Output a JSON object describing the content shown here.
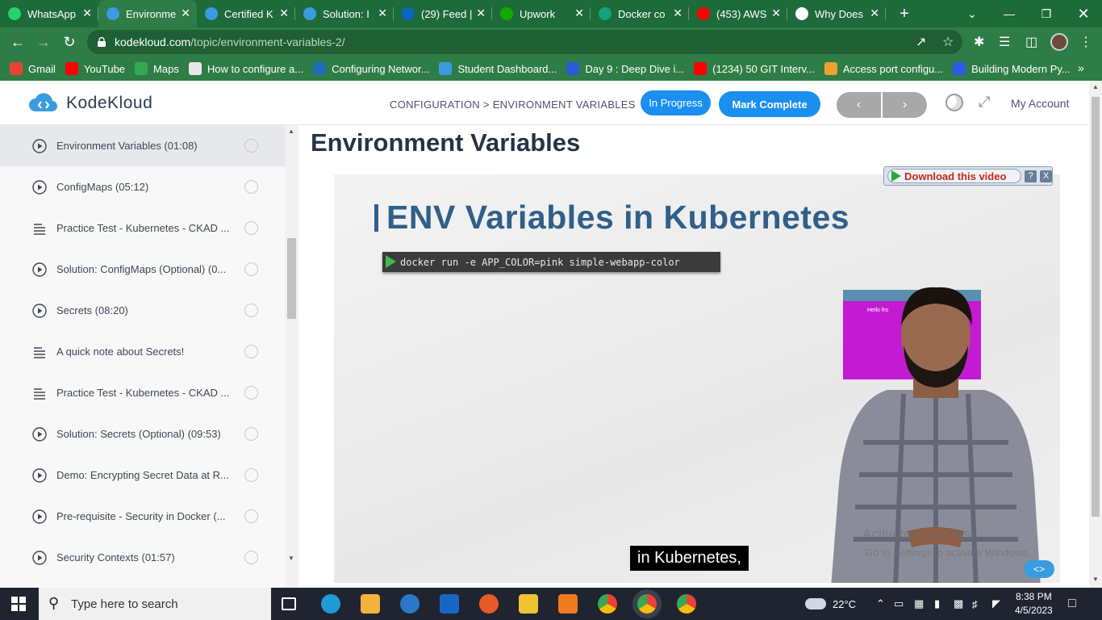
{
  "browser": {
    "tabs": [
      {
        "label": "WhatsApp",
        "icon": "whatsapp-icon",
        "color": "#25d366",
        "active": false
      },
      {
        "label": "Environme",
        "icon": "kodekloud-icon",
        "color": "#3b9be0",
        "active": true
      },
      {
        "label": "Certified K",
        "icon": "kodekloud-icon",
        "color": "#3b9be0",
        "active": false
      },
      {
        "label": "Solution: I",
        "icon": "kodekloud-icon",
        "color": "#3b9be0",
        "active": false
      },
      {
        "label": "(29) Feed |",
        "icon": "linkedin-icon",
        "color": "#0a66c2",
        "active": false
      },
      {
        "label": "Upwork",
        "icon": "upwork-icon",
        "color": "#14a800",
        "active": false
      },
      {
        "label": "Docker co",
        "icon": "openai-icon",
        "color": "#10a37f",
        "active": false
      },
      {
        "label": "(453) AWS",
        "icon": "youtube-icon",
        "color": "#ff0000",
        "active": false
      },
      {
        "label": "Why Does",
        "icon": "location-pin-icon",
        "color": "#ffffff",
        "active": false
      }
    ],
    "url_host": "kodekloud.com",
    "url_path": "/topic/environment-variables-2/",
    "bookmarks": [
      {
        "label": "Gmail",
        "icon": "gmail-icon",
        "color": "#ea4335"
      },
      {
        "label": "YouTube",
        "icon": "youtube-icon",
        "color": "#ff0000"
      },
      {
        "label": "Maps",
        "icon": "maps-icon",
        "color": "#34a853"
      },
      {
        "label": "How to configure a...",
        "icon": "page-icon",
        "color": "#e8e8e8"
      },
      {
        "label": "Configuring Networ...",
        "icon": "vmware-icon",
        "color": "#1d6fb8"
      },
      {
        "label": "Student Dashboard...",
        "icon": "kodekloud-icon",
        "color": "#3b9be0"
      },
      {
        "label": "Day 9 : Deep Dive i...",
        "icon": "diamond-icon",
        "color": "#2a5bd7"
      },
      {
        "label": "(1234) 50 GIT Interv...",
        "icon": "youtube-icon",
        "color": "#ff0000"
      },
      {
        "label": "Access port configu...",
        "icon": "blog-icon",
        "color": "#f0a030"
      },
      {
        "label": "Building Modern Py...",
        "icon": "c-icon",
        "color": "#2d5be3"
      }
    ]
  },
  "site": {
    "logo_text": "KodeKloud",
    "breadcrumb": "CONFIGURATION > ENVIRONMENT VARIABLES",
    "status_label": "In Progress",
    "mark_complete_label": "Mark Complete",
    "account_label": "My Account",
    "page_title": "Environment Variables"
  },
  "lessons": [
    {
      "label": "Environment Variables (01:08)",
      "type": "video",
      "active": true
    },
    {
      "label": "ConfigMaps (05:12)",
      "type": "video",
      "active": false
    },
    {
      "label": "Practice Test - Kubernetes - CKAD ...",
      "type": "text",
      "active": false
    },
    {
      "label": "Solution: ConfigMaps (Optional) (0...",
      "type": "video",
      "active": false
    },
    {
      "label": "Secrets (08:20)",
      "type": "video",
      "active": false
    },
    {
      "label": "A quick note about Secrets!",
      "type": "text",
      "active": false
    },
    {
      "label": "Practice Test - Kubernetes - CKAD ...",
      "type": "text",
      "active": false
    },
    {
      "label": "Solution: Secrets (Optional) (09:53)",
      "type": "video",
      "active": false
    },
    {
      "label": "Demo: Encrypting Secret Data at R...",
      "type": "video",
      "active": false
    },
    {
      "label": "Pre-requisite - Security in Docker (...",
      "type": "video",
      "active": false
    },
    {
      "label": "Security Contexts (01:57)",
      "type": "video",
      "active": false
    }
  ],
  "video": {
    "slide_title": "ENV Variables in Kubernetes",
    "command": "docker run  -e APP_COLOR=pink simple-webapp-color",
    "mini_text": "Hello fro",
    "caption": "in Kubernetes,",
    "watermark_line1": "Activate Windows",
    "watermark_line2": "Go to Settings to activate Windows.",
    "download_label": "Download this video",
    "help_label": "?",
    "close_label": "X"
  },
  "taskbar": {
    "search_placeholder": "Type here to search",
    "temperature": "22°C",
    "time": "8:38 PM",
    "date": "4/5/2023"
  }
}
